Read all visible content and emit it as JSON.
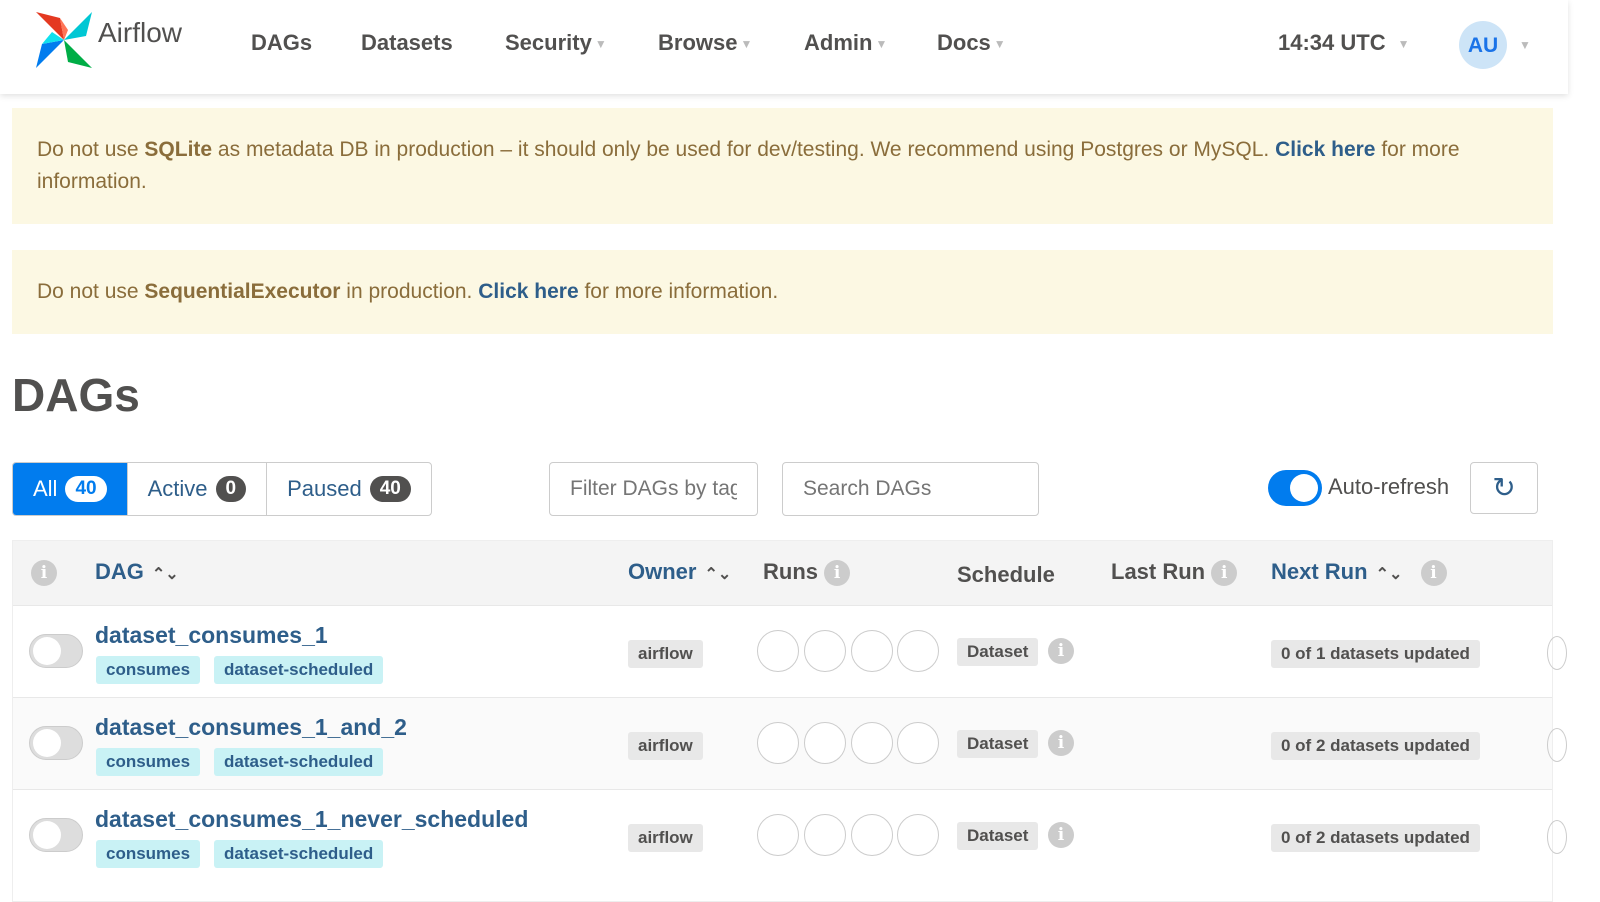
{
  "nav": {
    "brand": "Airflow",
    "items": [
      {
        "label": "DAGs",
        "dropdown": false
      },
      {
        "label": "Datasets",
        "dropdown": false
      },
      {
        "label": "Security",
        "dropdown": true
      },
      {
        "label": "Browse",
        "dropdown": true
      },
      {
        "label": "Admin",
        "dropdown": true
      },
      {
        "label": "Docs",
        "dropdown": true
      }
    ],
    "time": "14:34 UTC",
    "user_initials": "AU"
  },
  "alerts": [
    {
      "pre": "Do not use ",
      "bold": "SQLite",
      "mid": " as metadata DB in production – it should only be used for dev/testing. We recommend using Postgres or MySQL. ",
      "link": "Click here",
      "post": " for more information."
    },
    {
      "pre": "Do not use ",
      "bold": "SequentialExecutor",
      "mid": " in production. ",
      "link": "Click here",
      "post": " for more information."
    }
  ],
  "page_title": "DAGs",
  "filters": {
    "tabs": [
      {
        "label": "All",
        "count": "40",
        "active": true
      },
      {
        "label": "Active",
        "count": "0"
      },
      {
        "label": "Paused",
        "count": "40"
      }
    ],
    "tag_placeholder": "Filter DAGs by tag",
    "search_placeholder": "Search DAGs",
    "auto_refresh_label": "Auto-refresh",
    "auto_refresh_on": true
  },
  "table": {
    "headers": {
      "dag": "DAG",
      "owner": "Owner",
      "runs": "Runs",
      "schedule": "Schedule",
      "last_run": "Last Run",
      "next_run": "Next Run"
    },
    "rows": [
      {
        "name": "dataset_consumes_1",
        "tags": [
          "consumes",
          "dataset-scheduled"
        ],
        "owner": "airflow",
        "schedule": "Dataset",
        "next_run": "0 of 1 datasets updated",
        "paused": true
      },
      {
        "name": "dataset_consumes_1_and_2",
        "tags": [
          "consumes",
          "dataset-scheduled"
        ],
        "owner": "airflow",
        "schedule": "Dataset",
        "next_run": "0 of 2 datasets updated",
        "paused": true
      },
      {
        "name": "dataset_consumes_1_never_scheduled",
        "tags": [
          "consumes",
          "dataset-scheduled"
        ],
        "owner": "airflow",
        "schedule": "Dataset",
        "next_run": "0 of 2 datasets updated",
        "paused": true
      }
    ]
  },
  "colors": {
    "primary": "#017cee",
    "link": "#2e5e8a",
    "alert_bg": "#fcf8e3",
    "tag_bg": "#c9f2f5"
  }
}
